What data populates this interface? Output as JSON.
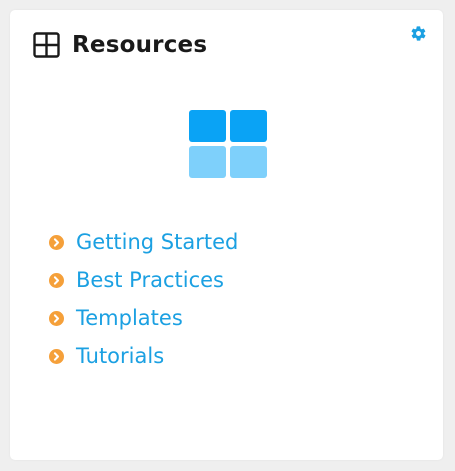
{
  "widget": {
    "title": "Resources",
    "accent_color": "#1ba0e2",
    "bullet_color": "#f5a03a",
    "icons": {
      "title": "grid-icon",
      "settings": "gear-icon",
      "hero": "tiles-icon",
      "bullet": "chevron-right-circle-icon"
    },
    "links": [
      {
        "label": "Getting Started"
      },
      {
        "label": "Best Practices"
      },
      {
        "label": "Templates"
      },
      {
        "label": "Tutorials"
      }
    ]
  }
}
